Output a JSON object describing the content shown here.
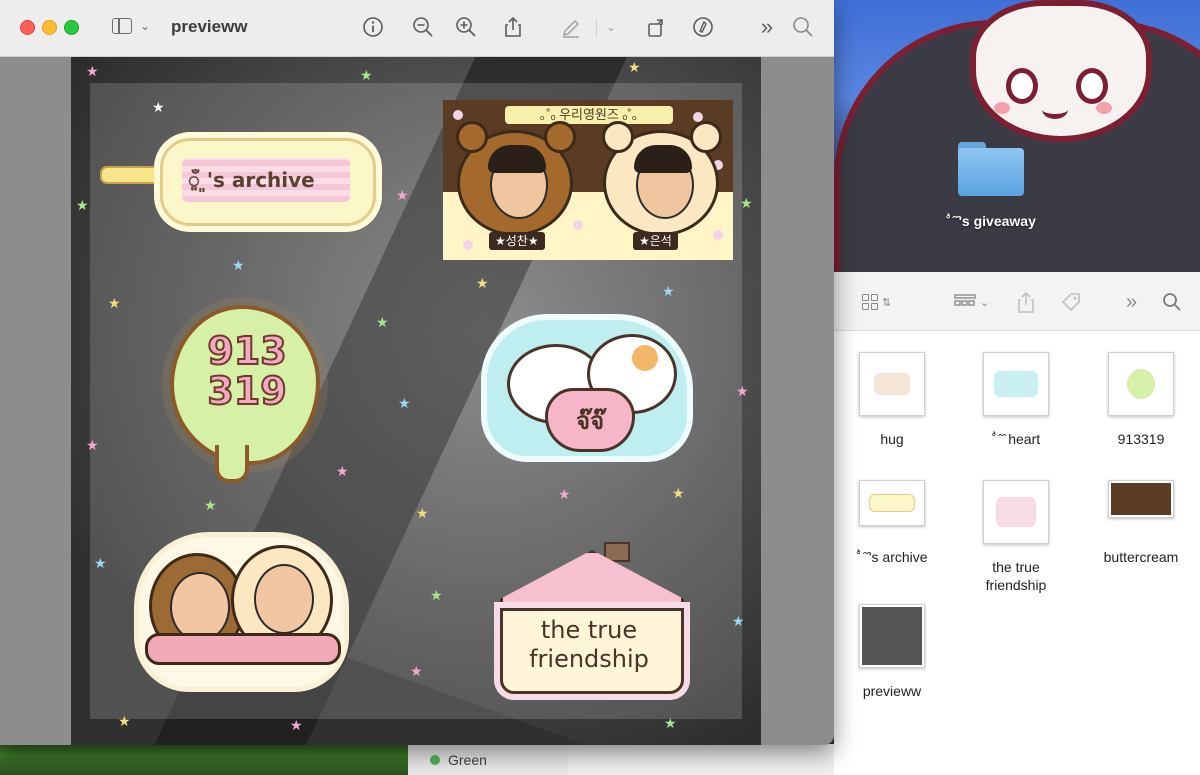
{
  "preview": {
    "window_title": "previeww",
    "toolbar_icons": [
      "info-icon",
      "zoom-out-icon",
      "zoom-in-icon",
      "share-icon",
      "markup-pen-icon",
      "chevron-down-icon",
      "rotate-icon",
      "markup-icon",
      "more-chevrons-icon",
      "search-icon"
    ]
  },
  "stickers": {
    "banner_text": "ँ͈ ͈'s archive",
    "kids_title": "｡˚ₒ 우리영원즈 ₒ˚｡",
    "kid_left": "★성찬★",
    "kid_right": "★은석",
    "clover_text": "913\n319",
    "pets_heart_text": "จ๊จ๊",
    "house_text_1": "the true",
    "house_text_2": "friendship"
  },
  "desktop": {
    "folder_label": "˚̀ ̑ ̑'s giveaway",
    "dock_label": "Green"
  },
  "finder": {
    "toolbar_icons": [
      "icon-view-icon",
      "group-icon",
      "share-icon",
      "tag-icon",
      "more-chevrons-icon",
      "search-icon"
    ],
    "files": [
      {
        "name": "hug"
      },
      {
        "name": "˚̀ ̑ ̑ heart"
      },
      {
        "name": "913319"
      },
      {
        "name": "˚̀ ̑ ̑'s archive"
      },
      {
        "name": "the true\nfriendship"
      },
      {
        "name": "buttercream"
      },
      {
        "name": "previeww"
      }
    ]
  },
  "colors": {
    "traffic_red": "#fe5f57",
    "traffic_yellow": "#febc2e",
    "traffic_green": "#28c840",
    "folder_blue": "#5aa2e0"
  }
}
